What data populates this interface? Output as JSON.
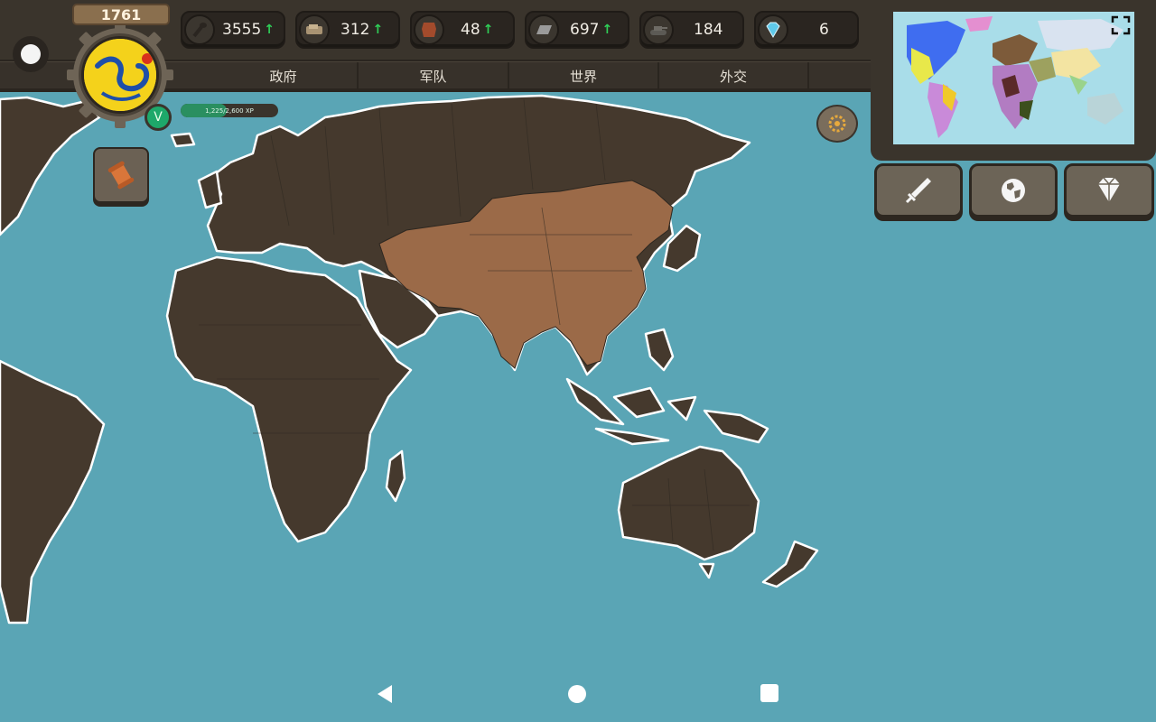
{
  "game": {
    "year": "1761",
    "level_badge": "V",
    "xp_text": "1,225/2,600 XP",
    "xp_progress": 0.47
  },
  "resources": [
    {
      "name": "money",
      "icon": "club-icon",
      "value": "3555",
      "trend": "up"
    },
    {
      "name": "supplies",
      "icon": "crate-icon",
      "value": "312",
      "trend": "up"
    },
    {
      "name": "manpower",
      "icon": "hide-icon",
      "value": "48",
      "trend": "up"
    },
    {
      "name": "iron",
      "icon": "ingot-icon",
      "value": "697",
      "trend": "up"
    },
    {
      "name": "tanks",
      "icon": "tank-icon",
      "value": "184",
      "trend": "none"
    },
    {
      "name": "gems",
      "icon": "diamond-icon",
      "value": "6",
      "trend": "none"
    }
  ],
  "tabs": [
    {
      "label": "政府"
    },
    {
      "label": "军队"
    },
    {
      "label": "世界"
    },
    {
      "label": "外交"
    }
  ],
  "action_buttons": [
    {
      "name": "war",
      "icon": "sword-icon"
    },
    {
      "name": "world",
      "icon": "globe-icon"
    },
    {
      "name": "shop",
      "icon": "diamond-icon"
    }
  ],
  "colors": {
    "ocean": "#5aa5b5",
    "land": "#45392d",
    "player_territory": "#9b6a48",
    "ui_dark": "#3a342c",
    "accent_green": "#2fcf57"
  },
  "nav": {
    "back_icon": "back-triangle-icon",
    "home_icon": "home-circle-icon",
    "recent_icon": "recent-square-icon"
  }
}
